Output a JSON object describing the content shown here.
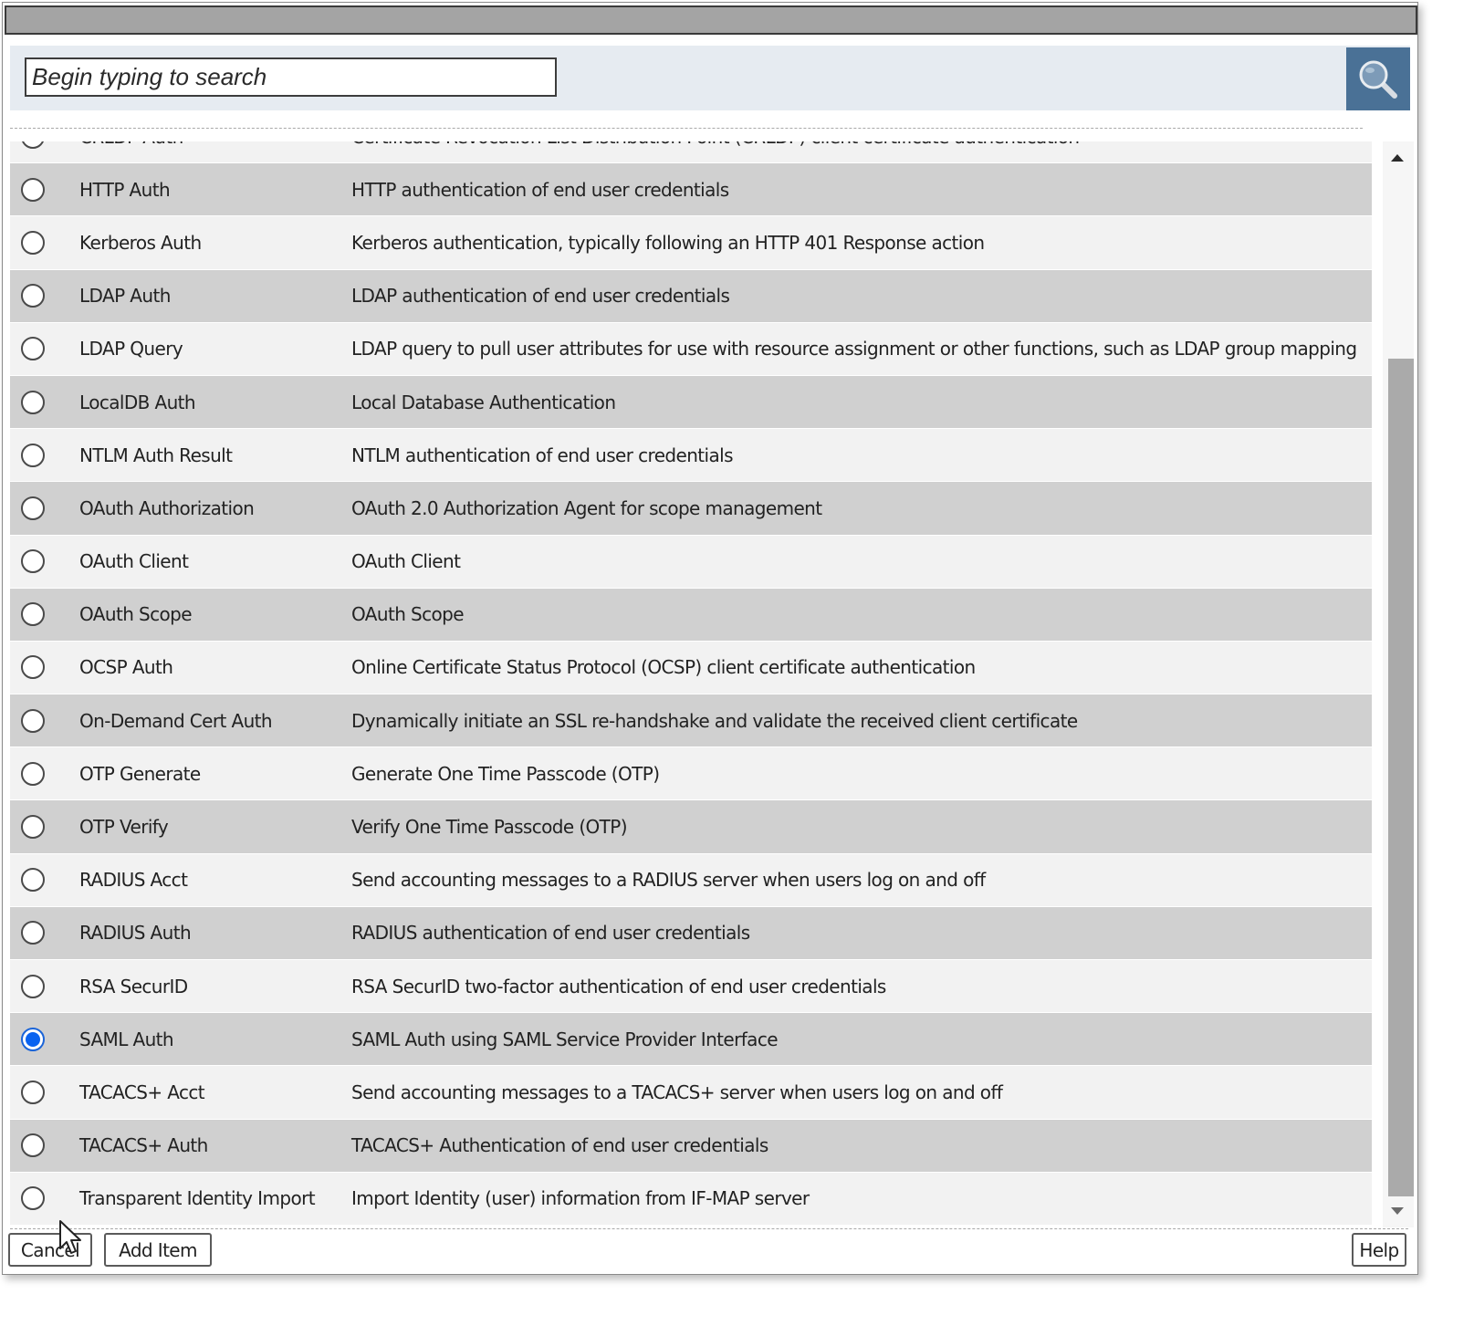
{
  "dialog": {
    "title": ""
  },
  "search": {
    "placeholder": "Begin typing to search",
    "value": "",
    "button_icon": "magnifier-icon"
  },
  "list": {
    "selected": "SAML Auth",
    "items": [
      {
        "name": "CRLDP Auth",
        "description": "Certificate Revocation List Distribution Point (CRLDP) client certificate authentication",
        "checked": false
      },
      {
        "name": "HTTP Auth",
        "description": "HTTP authentication of end user credentials",
        "checked": false
      },
      {
        "name": "Kerberos Auth",
        "description": "Kerberos authentication, typically following an HTTP 401 Response action",
        "checked": false
      },
      {
        "name": "LDAP Auth",
        "description": "LDAP authentication of end user credentials",
        "checked": false
      },
      {
        "name": "LDAP Query",
        "description": "LDAP query to pull user attributes for use with resource assignment or other functions, such as LDAP group mapping",
        "checked": false
      },
      {
        "name": "LocalDB Auth",
        "description": "Local Database Authentication",
        "checked": false
      },
      {
        "name": "NTLM Auth Result",
        "description": "NTLM authentication of end user credentials",
        "checked": false
      },
      {
        "name": "OAuth Authorization",
        "description": "OAuth 2.0 Authorization Agent for scope management",
        "checked": false
      },
      {
        "name": "OAuth Client",
        "description": "OAuth Client",
        "checked": false
      },
      {
        "name": "OAuth Scope",
        "description": "OAuth Scope",
        "checked": false
      },
      {
        "name": "OCSP Auth",
        "description": "Online Certificate Status Protocol (OCSP) client certificate authentication",
        "checked": false
      },
      {
        "name": "On-Demand Cert Auth",
        "description": "Dynamically initiate an SSL re-handshake and validate the received client certificate",
        "checked": false
      },
      {
        "name": "OTP Generate",
        "description": "Generate One Time Passcode (OTP)",
        "checked": false
      },
      {
        "name": "OTP Verify",
        "description": "Verify One Time Passcode (OTP)",
        "checked": false
      },
      {
        "name": "RADIUS Acct",
        "description": "Send accounting messages to a RADIUS server when users log on and off",
        "checked": false
      },
      {
        "name": "RADIUS Auth",
        "description": "RADIUS authentication of end user credentials",
        "checked": false
      },
      {
        "name": "RSA SecurID",
        "description": "RSA SecurID two-factor authentication of end user credentials",
        "checked": false
      },
      {
        "name": "SAML Auth",
        "description": "SAML Auth using SAML Service Provider Interface",
        "checked": true
      },
      {
        "name": "TACACS+ Acct",
        "description": "Send accounting messages to a TACACS+ server when users log on and off",
        "checked": false
      },
      {
        "name": "TACACS+ Auth",
        "description": "TACACS+ Authentication of end user credentials",
        "checked": false
      },
      {
        "name": "Transparent Identity Import",
        "description": "Import Identity (user) information from IF-MAP server",
        "checked": false
      }
    ]
  },
  "scroll": {
    "position_fraction": 0.2
  },
  "footer": {
    "cancel_label": "Cancel",
    "add_item_label": "Add Item",
    "help_label": "Help"
  },
  "colors": {
    "search_button": "#4a7196",
    "selected_radio": "#0a63f0",
    "row_alt": "#d0d0d0",
    "row_base": "#f2f2f2"
  }
}
